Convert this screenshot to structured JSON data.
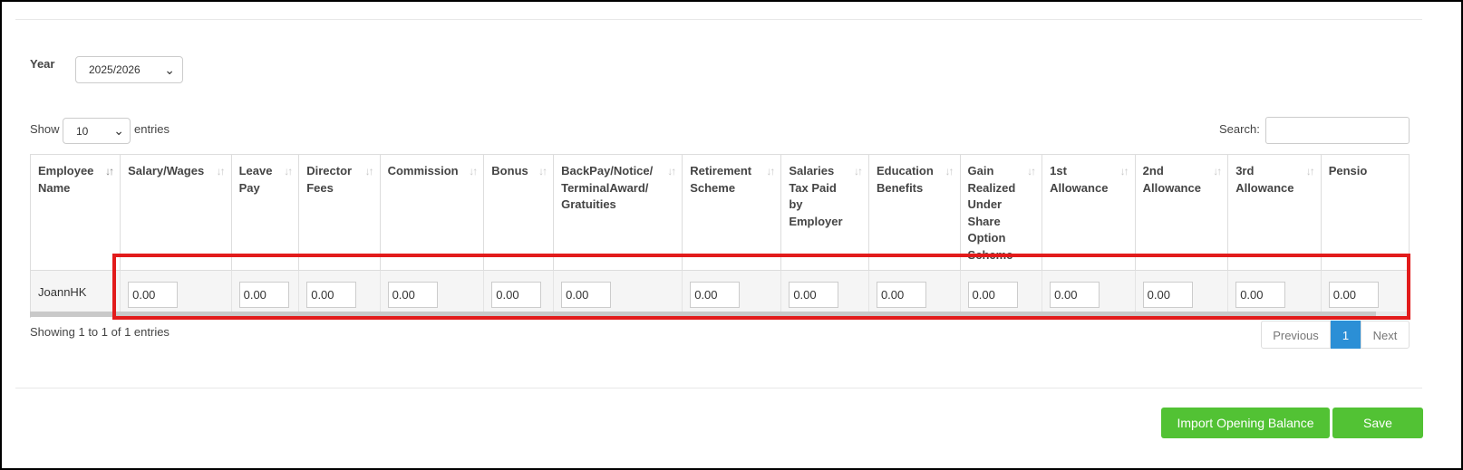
{
  "filters": {
    "year_label": "Year",
    "year_value": "2025/2026",
    "show_label": "Show",
    "page_length": "10",
    "entries_label": "entries",
    "search_label": "Search:",
    "search_value": ""
  },
  "table": {
    "columns": [
      "Employee Name",
      "Salary/Wages",
      "Leave Pay",
      "Director Fees",
      "Commission",
      "Bonus",
      "BackPay/Notice/ TerminalAward/ Gratuities",
      "Retirement Scheme",
      "Salaries Tax Paid by Employer",
      "Education Benefits",
      "Gain Realized Under Share Option Scheme",
      "1st Allowance",
      "2nd Allowance",
      "3rd Allowance",
      "Pensio"
    ],
    "rows": [
      {
        "employee": "JoannHK",
        "values": [
          "0.00",
          "0.00",
          "0.00",
          "0.00",
          "0.00",
          "0.00",
          "0.00",
          "0.00",
          "0.00",
          "0.00",
          "0.00",
          "0.00",
          "0.00",
          "0.00"
        ]
      }
    ]
  },
  "footer": {
    "info": "Showing 1 to 1 of 1 entries",
    "previous": "Previous",
    "current_page": "1",
    "next": "Next"
  },
  "actions": {
    "import_label": "Import Opening Balance",
    "save_label": "Save"
  },
  "colors": {
    "accent_green": "#52c234",
    "page_blue": "#2b8fd6",
    "highlight_red": "#e21b1b"
  },
  "icons": {
    "sort": "sort-icon",
    "dropdown": "chevron-down-icon"
  }
}
